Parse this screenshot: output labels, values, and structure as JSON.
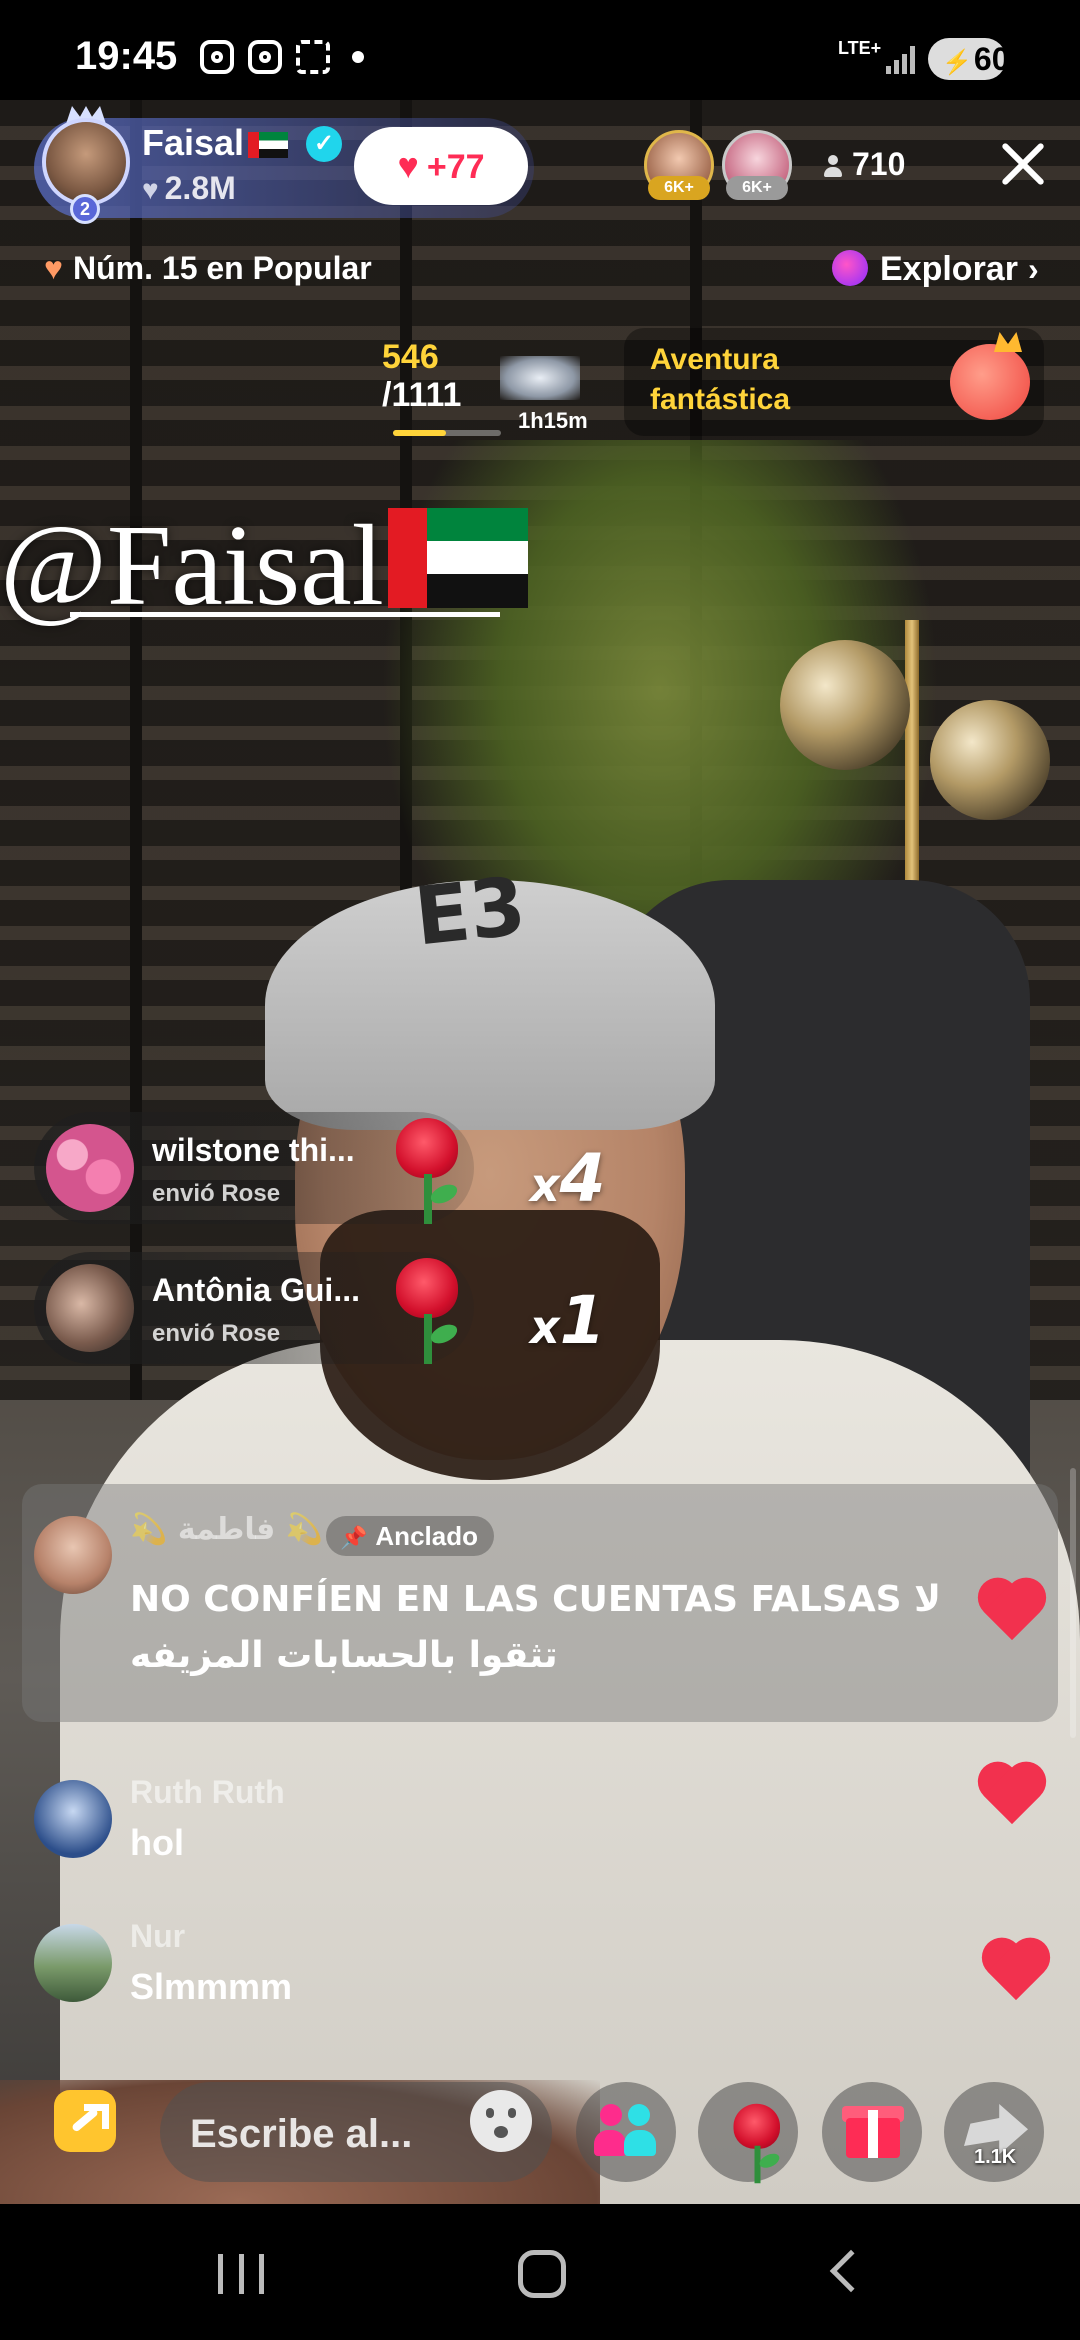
{
  "status_bar": {
    "time": "19:45",
    "network": "LTE+",
    "battery": "60",
    "icons": [
      "instagram-icon",
      "instagram-icon",
      "screen-capture-icon",
      "notification-dot-icon",
      "signal-icon",
      "battery-icon"
    ]
  },
  "host": {
    "name": "Faisal",
    "likes": "2.8M",
    "rank_level": "2",
    "verified": true,
    "like_button": "+77"
  },
  "viewers": {
    "top_badges": [
      "6K+",
      "6K+"
    ],
    "count": "710"
  },
  "popular_rank": "Núm. 15 en Popular",
  "explore_label": "Explorar",
  "goal": {
    "current": "546",
    "target": "/1111",
    "progress_fraction": 0.49,
    "time_left": "1h15m",
    "adventure_line1": "Aventura",
    "adventure_line2": "fantástica"
  },
  "watermark_text": "@Faisal",
  "gifts": [
    {
      "user": "wilstone thi...",
      "action": "envió Rose",
      "multiplier": "4",
      "gift": "rose-icon"
    },
    {
      "user": "Antônia Gui...",
      "action": "envió Rose",
      "multiplier": "1",
      "gift": "rose-icon"
    }
  ],
  "pinned": {
    "user": "💫 فاطمة 💫",
    "tag": "Anclado",
    "text": "NO CONFÍEN EN LAS CUENTAS FALSAS لا تثقوا بالحسابات المزيفه"
  },
  "comments": [
    {
      "user": "Ruth Ruth",
      "text": "hol"
    },
    {
      "user": "Nur",
      "text": "Slmmmm"
    }
  ],
  "bottom_bar": {
    "comment_placeholder": "Escribe al...",
    "share_count": "1.1K"
  },
  "colors": {
    "accent_pink": "#fe2c55",
    "goal_yellow": "#ffd43a",
    "verified_blue": "#20d5ec"
  }
}
